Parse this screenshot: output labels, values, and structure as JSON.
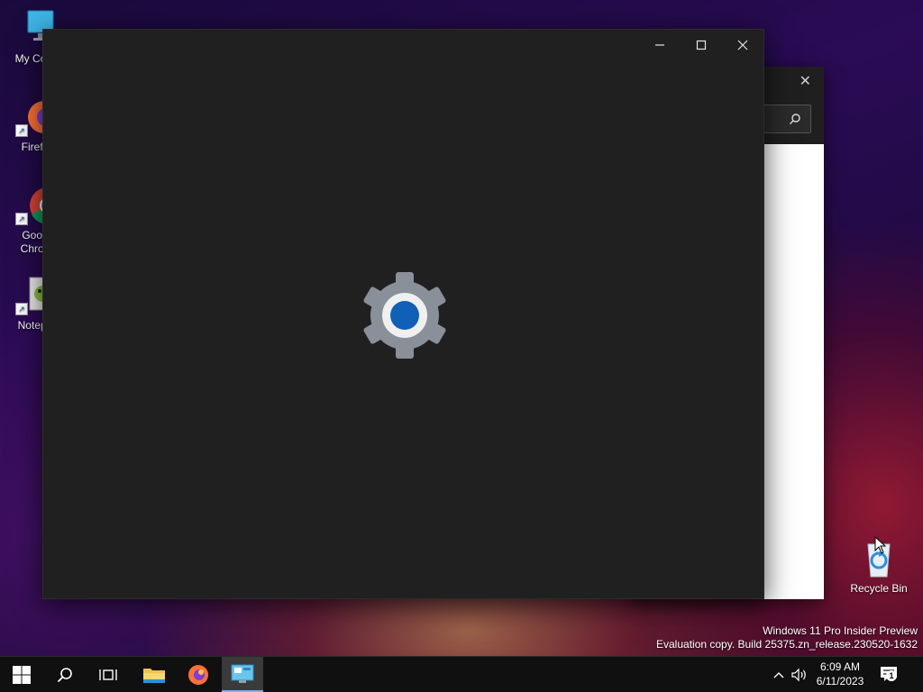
{
  "desktop": {
    "icons": [
      {
        "label": "My Com"
      },
      {
        "label": "Firefo"
      },
      {
        "label_line1": "Goog",
        "label_line2": "Chron"
      },
      {
        "label": "Notepa"
      },
      {
        "label": "Recycle Bin"
      }
    ]
  },
  "settings_window": {
    "icon": "gear-icon"
  },
  "watermark": {
    "line1": "Windows 11 Pro Insider Preview",
    "line2": "Evaluation copy. Build 25375.zn_release.230520-1632"
  },
  "taskbar": {
    "clock_time": "6:09 AM",
    "clock_date": "6/11/2023",
    "notification_count": "1"
  },
  "colors": {
    "accent": "#1a5fb4",
    "window_bg": "#202020",
    "taskbar_bg": "#101010"
  }
}
